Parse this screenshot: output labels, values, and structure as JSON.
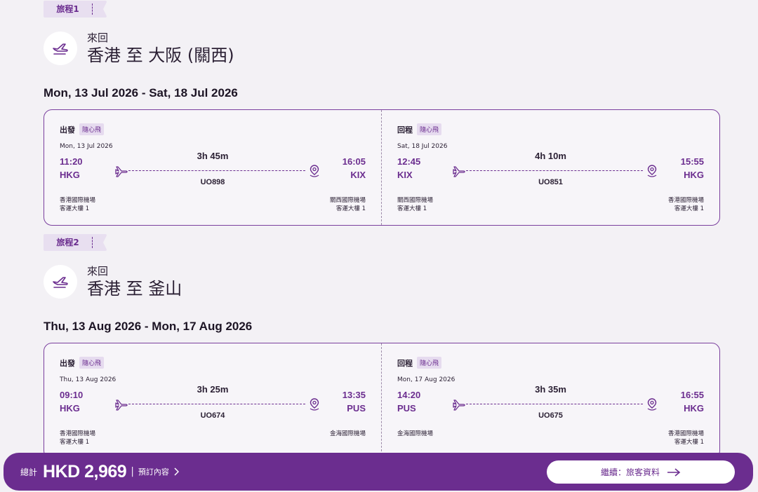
{
  "trips": [
    {
      "tag": "旅程1",
      "type": "來回",
      "route": "香港 至 大阪 (關西)",
      "dates": "Mon, 13 Jul 2026 - Sat, 18 Jul 2026",
      "legs": [
        {
          "direction": "出發",
          "badge": "隨心飛",
          "date": "Mon, 13 Jul 2026",
          "dep_time": "11:20",
          "dep_code": "HKG",
          "arr_time": "16:05",
          "arr_code": "KIX",
          "duration": "3h 45m",
          "flight": "UO898",
          "dep_airport": "香港國際機場",
          "dep_terminal": "客運大樓 1",
          "arr_airport": "關西國際機場",
          "arr_terminal": "客運大樓 1"
        },
        {
          "direction": "回程",
          "badge": "隨心飛",
          "date": "Sat, 18 Jul 2026",
          "dep_time": "12:45",
          "dep_code": "KIX",
          "arr_time": "15:55",
          "arr_code": "HKG",
          "duration": "4h 10m",
          "flight": "UO851",
          "dep_airport": "關西國際機場",
          "dep_terminal": "客運大樓 1",
          "arr_airport": "香港國際機場",
          "arr_terminal": "客運大樓 1"
        }
      ]
    },
    {
      "tag": "旅程2",
      "type": "來回",
      "route": "香港 至 釜山",
      "dates": "Thu, 13 Aug 2026 - Mon, 17 Aug 2026",
      "legs": [
        {
          "direction": "出發",
          "badge": "隨心飛",
          "date": "Thu, 13 Aug 2026",
          "dep_time": "09:10",
          "dep_code": "HKG",
          "arr_time": "13:35",
          "arr_code": "PUS",
          "duration": "3h 25m",
          "flight": "UO674",
          "dep_airport": "香港國際機場",
          "dep_terminal": "客運大樓 1",
          "arr_airport": "金海國際機場",
          "arr_terminal": ""
        },
        {
          "direction": "回程",
          "badge": "隨心飛",
          "date": "Mon, 17 Aug 2026",
          "dep_time": "14:20",
          "dep_code": "PUS",
          "arr_time": "16:55",
          "arr_code": "HKG",
          "duration": "3h 35m",
          "flight": "UO675",
          "dep_airport": "金海國際機場",
          "dep_terminal": "",
          "arr_airport": "香港國際機場",
          "arr_terminal": "客運大樓 1"
        }
      ]
    }
  ],
  "footer": {
    "total_label": "總計",
    "total_amount": "HKD 2,969",
    "separator": "|",
    "details_label": "預訂內容",
    "details_icon": "chevron-right-icon",
    "continue_label": "繼續：旅客資料",
    "continue_icon": "arrow-right-icon"
  },
  "colors": {
    "brand": "#6b2d8f",
    "background": "#f3f1f5",
    "tag_bg": "#e8dff0"
  }
}
